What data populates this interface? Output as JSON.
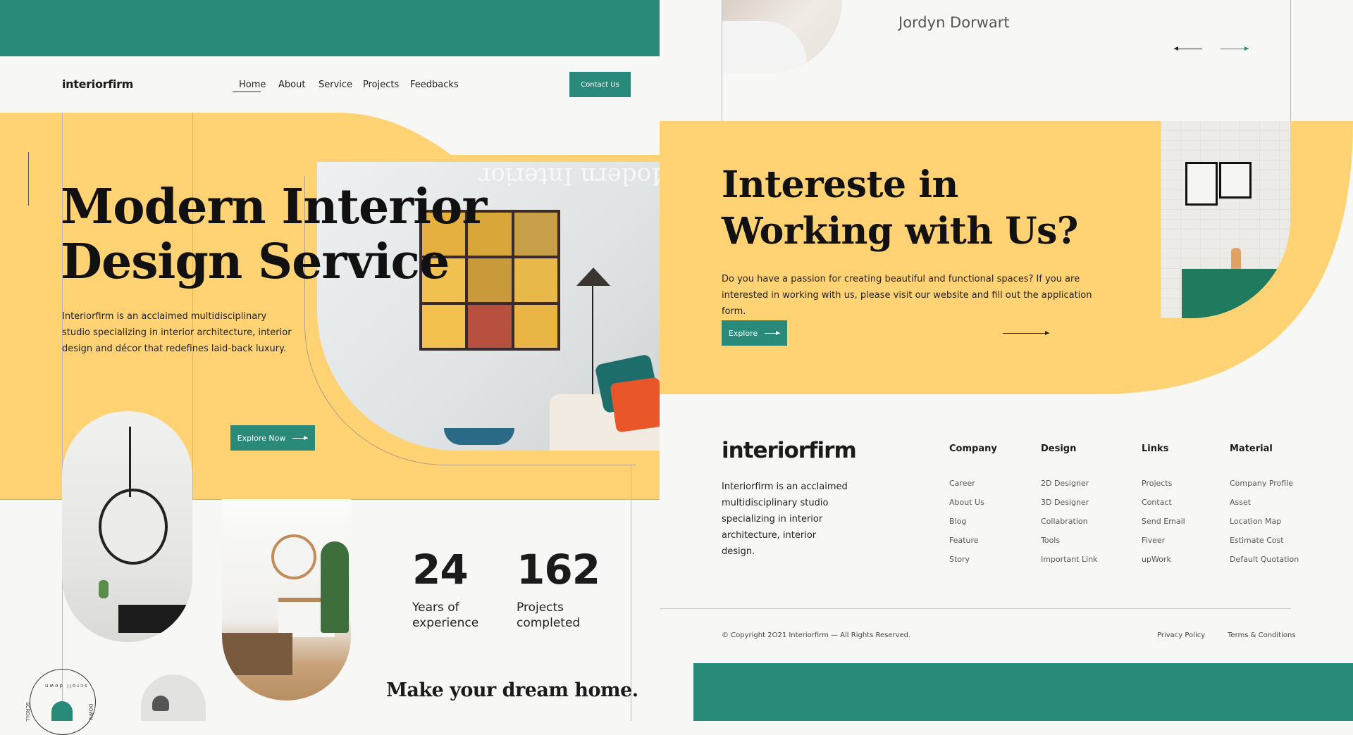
{
  "brand": {
    "logo": "interiorfirm"
  },
  "nav": {
    "items": [
      "Home",
      "About",
      "Service",
      "Projects",
      "Feedbacks"
    ],
    "active": "Home",
    "contact_label": "Contact Us"
  },
  "hero": {
    "title_line1": "Modern Interior",
    "title_line2": "Design Service",
    "watermark": "Modern Interior",
    "description": "Interiorfirm is an acclaimed multidisciplinary studio specializing in interior architecture, interior design and décor that redefines laid-back luxury.",
    "cta_label": "Explore Now"
  },
  "stats": [
    {
      "number": "24",
      "label_line1": "Years of",
      "label_line2": "experience"
    },
    {
      "number": "162",
      "label_line1": "Projects",
      "label_line2": "completed"
    }
  ],
  "tagline": "Make your dream home.",
  "scroll_badge": {
    "left": "SCROLL",
    "top": "scroll down",
    "right": "DOWN"
  },
  "testimonial": {
    "name": "Jordyn Dorwart"
  },
  "cta_section": {
    "title_line1": "Intereste in",
    "title_line2": "Working with Us?",
    "description": "Do you have a passion for creating beautiful and functional spaces? If you are interested in working with us, please visit our website and fill out the application form.",
    "button_label": "Explore"
  },
  "footer": {
    "logo": "interiorfirm",
    "description": "Interiorfirm is an acclaimed multidisciplinary studio specializing in interior architecture, interior design.",
    "columns": [
      {
        "title": "Company",
        "links": [
          "Career",
          "About Us",
          "Blog",
          "Feature",
          "Story"
        ]
      },
      {
        "title": "Design",
        "links": [
          "2D Designer",
          "3D Designer",
          "Collabration",
          "Tools",
          "Important Link"
        ]
      },
      {
        "title": "Links",
        "links": [
          "Projects",
          "Contact",
          "Send Email",
          "Fiveer",
          "upWork"
        ]
      },
      {
        "title": "Material",
        "links": [
          "Company Profile",
          "Asset",
          "Location Map",
          "Estimate Cost",
          "Default Quotation"
        ]
      }
    ],
    "copyright": "© Copyright 2O21 Interiorfirm — All Rights Reserved.",
    "privacy": "Privacy Policy",
    "terms": "Terms & Conditions"
  },
  "colors": {
    "teal": "#2a8a7a",
    "yellow": "#ffd374",
    "background": "#f7f8f6"
  }
}
